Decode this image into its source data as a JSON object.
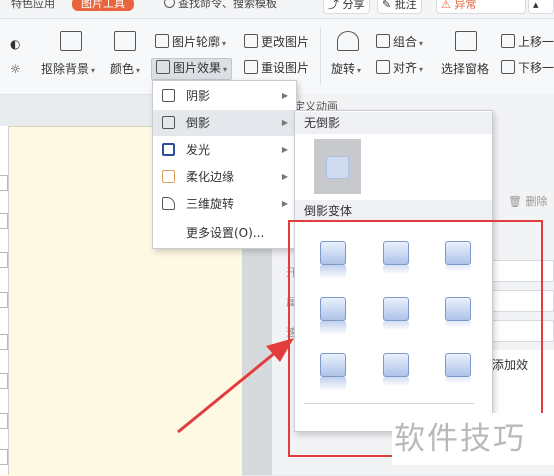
{
  "tabs": {
    "special_apps": "特色应用",
    "picture_tools": "图片工具",
    "search": "查找命令、搜索模板",
    "share": "分享",
    "annotate": "批注",
    "abnormal": "异常"
  },
  "ribbon": {
    "remove_bg": "抠除背景",
    "color": "颜色",
    "outline": "图片轮廓",
    "effects": "图片效果",
    "change_pic": "更改图片",
    "reset_pic": "重设图片",
    "rotate": "旋转",
    "group": "组合",
    "align": "对齐",
    "selection_pane": "选择窗格",
    "bring_forward": "上移一",
    "send_backward": "下移一"
  },
  "menu": {
    "items": [
      {
        "label": "阴影",
        "icon": "shadow-icon"
      },
      {
        "label": "倒影",
        "icon": "reflection-icon"
      },
      {
        "label": "发光",
        "icon": "glow-icon"
      },
      {
        "label": "柔化边缘",
        "icon": "soft-edge-icon"
      },
      {
        "label": "三维旋转",
        "icon": "3d-rotation-icon"
      }
    ],
    "more": "更多设置(O)..."
  },
  "submenu": {
    "no_reflection": "无倒影",
    "variants_header": "倒影变体",
    "variant_count": 9
  },
  "right_panel": {
    "custom_anim": "定义动画",
    "delete": "删除",
    "field_labels": [
      "开",
      "属",
      "速"
    ],
    "add_effect": "添加效"
  },
  "watermark": "软件技巧",
  "colors": {
    "accent_tab": "#e8643c",
    "highlight_box": "#e23c3c",
    "arrow": "#e23c3c",
    "document_bg": "#fdf9e3"
  }
}
